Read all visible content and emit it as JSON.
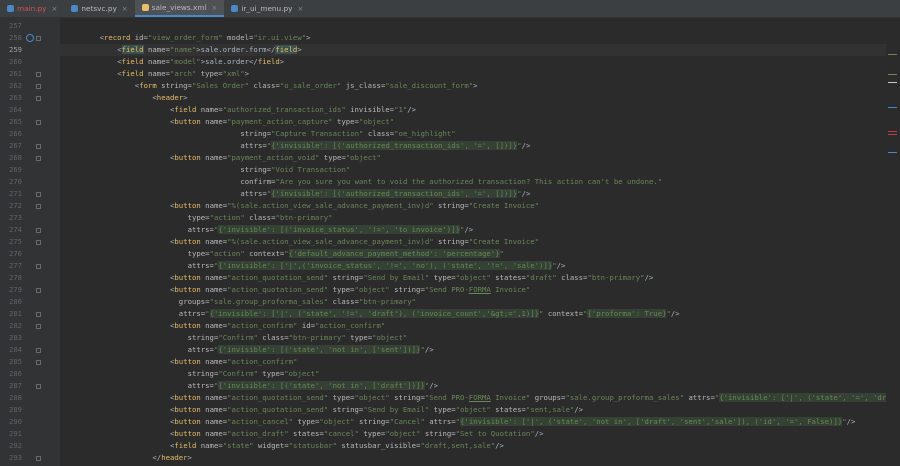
{
  "tabs": [
    {
      "label": "main.py",
      "active": false,
      "error": true,
      "icon_color": "#4a88c7"
    },
    {
      "label": "netsvc.py",
      "active": false,
      "error": false,
      "icon_color": "#4a88c7"
    },
    {
      "label": "sale_views.xml",
      "active": true,
      "error": false,
      "icon_color": "#e8bf6a"
    },
    {
      "label": "ir_ui_menu.py",
      "active": false,
      "error": false,
      "icon_color": "#4a88c7"
    }
  ],
  "inspections": {
    "errors": "6",
    "error_icon": "error-circle-icon",
    "warnings": "2",
    "warning_icon": "warning-triangle-icon",
    "ok": "58",
    "ok_icon": "checkmark-icon",
    "arrow_up": "˄",
    "arrow_down": "˅"
  },
  "current_line_index": 2,
  "lines": [
    {
      "n": "257",
      "indent": 0,
      "tokens": []
    },
    {
      "n": "258",
      "indent": 1,
      "fold": true,
      "bookmark": true,
      "tokens": [
        [
          "p",
          "<"
        ],
        [
          "t",
          "record "
        ],
        [
          "a",
          "id="
        ],
        [
          "v",
          "\"view_order_form\" "
        ],
        [
          "a",
          "model="
        ],
        [
          "v",
          "\"ir.ui.view\""
        ],
        [
          "p",
          ">"
        ]
      ]
    },
    {
      "n": "259",
      "indent": 2,
      "tokens": [
        [
          "p",
          "<"
        ],
        [
          "t",
          "field",
          "tg"
        ],
        [
          "a",
          " name="
        ],
        [
          "v",
          "\"name\""
        ],
        [
          "p",
          ">sale.order.form</"
        ],
        [
          "t",
          "field",
          "tg"
        ],
        [
          "p",
          ">"
        ]
      ]
    },
    {
      "n": "260",
      "indent": 2,
      "tokens": [
        [
          "p",
          "<"
        ],
        [
          "t",
          "field "
        ],
        [
          "a",
          "name="
        ],
        [
          "v",
          "\"model\""
        ],
        [
          "p",
          ">sale.order</"
        ],
        [
          "t",
          "field"
        ],
        [
          "p",
          ">"
        ]
      ]
    },
    {
      "n": "261",
      "indent": 2,
      "fold": true,
      "tokens": [
        [
          "p",
          "<"
        ],
        [
          "t",
          "field "
        ],
        [
          "a",
          "name="
        ],
        [
          "v",
          "\"arch\" "
        ],
        [
          "a",
          "type="
        ],
        [
          "v",
          "\"xml\""
        ],
        [
          "p",
          ">"
        ]
      ]
    },
    {
      "n": "262",
      "indent": 3,
      "fold": true,
      "tokens": [
        [
          "p",
          "<"
        ],
        [
          "t",
          "form "
        ],
        [
          "a",
          "string="
        ],
        [
          "v",
          "\"Sales Order\" "
        ],
        [
          "a",
          "class="
        ],
        [
          "v",
          "\"o_sale_order\" "
        ],
        [
          "a",
          "js_class="
        ],
        [
          "v",
          "\"sale_discount_form\""
        ],
        [
          "p",
          ">"
        ]
      ]
    },
    {
      "n": "263",
      "indent": 4,
      "fold": true,
      "tokens": [
        [
          "p",
          "<"
        ],
        [
          "t",
          "header"
        ],
        [
          "p",
          ">"
        ]
      ]
    },
    {
      "n": "264",
      "indent": 5,
      "tokens": [
        [
          "p",
          "<"
        ],
        [
          "t",
          "field "
        ],
        [
          "a",
          "name="
        ],
        [
          "v",
          "\"authorized_transaction_ids\" "
        ],
        [
          "a",
          "invisible="
        ],
        [
          "v",
          "\"1\""
        ],
        [
          "p",
          "/>"
        ]
      ]
    },
    {
      "n": "265",
      "indent": 5,
      "fold": true,
      "tokens": [
        [
          "p",
          "<"
        ],
        [
          "t",
          "button "
        ],
        [
          "a",
          "name="
        ],
        [
          "v",
          "\"payment_action_capture\" "
        ],
        [
          "a",
          "type="
        ],
        [
          "v",
          "\"object\""
        ]
      ]
    },
    {
      "n": "266",
      "indent": 9,
      "tokens": [
        [
          "a",
          "string="
        ],
        [
          "v",
          "\"Capture Transaction\" "
        ],
        [
          "a",
          "class="
        ],
        [
          "v",
          "\"oe_highlight\""
        ]
      ]
    },
    {
      "n": "267",
      "indent": 9,
      "fold": true,
      "tokens": [
        [
          "a",
          "attrs="
        ],
        [
          "v",
          "\""
        ],
        [
          "v",
          "{'invisible': [('authorized_transaction_ids', '=', [])]}",
          "hl"
        ],
        [
          "v",
          "\""
        ],
        [
          "p",
          "/>"
        ]
      ]
    },
    {
      "n": "268",
      "indent": 5,
      "fold": true,
      "tokens": [
        [
          "p",
          "<"
        ],
        [
          "t",
          "button "
        ],
        [
          "a",
          "name="
        ],
        [
          "v",
          "\"payment_action_void\" "
        ],
        [
          "a",
          "type="
        ],
        [
          "v",
          "\"object\""
        ]
      ]
    },
    {
      "n": "269",
      "indent": 9,
      "tokens": [
        [
          "a",
          "string="
        ],
        [
          "v",
          "\"Void Transaction\""
        ]
      ]
    },
    {
      "n": "270",
      "indent": 9,
      "tokens": [
        [
          "a",
          "confirm="
        ],
        [
          "v",
          "\"Are you sure you want to void the authorized transaction? This action can't be undone.\""
        ]
      ]
    },
    {
      "n": "271",
      "indent": 9,
      "fold": true,
      "tokens": [
        [
          "a",
          "attrs="
        ],
        [
          "v",
          "\""
        ],
        [
          "v",
          "{'invisible': [('authorized_transaction_ids', '=', [])]}",
          "hl"
        ],
        [
          "v",
          "\""
        ],
        [
          "p",
          "/>"
        ]
      ]
    },
    {
      "n": "272",
      "indent": 5,
      "fold": true,
      "tokens": [
        [
          "p",
          "<"
        ],
        [
          "t",
          "button "
        ],
        [
          "a",
          "name="
        ],
        [
          "v",
          "\"%(sale.action_view_sale_advance_payment_inv)d\" "
        ],
        [
          "a",
          "string="
        ],
        [
          "v",
          "\"Create Invoice\""
        ]
      ]
    },
    {
      "n": "273",
      "indent": 6,
      "tokens": [
        [
          "a",
          "type="
        ],
        [
          "v",
          "\"action\" "
        ],
        [
          "a",
          "class="
        ],
        [
          "v",
          "\"btn-primary\""
        ]
      ]
    },
    {
      "n": "274",
      "indent": 6,
      "fold": true,
      "tokens": [
        [
          "a",
          "attrs="
        ],
        [
          "v",
          "\""
        ],
        [
          "v",
          "{'invisible': [('invoice_status', '!=', 'to invoice')]}",
          "hl"
        ],
        [
          "v",
          "\""
        ],
        [
          "p",
          "/>"
        ]
      ]
    },
    {
      "n": "275",
      "indent": 5,
      "fold": true,
      "tokens": [
        [
          "p",
          "<"
        ],
        [
          "t",
          "button "
        ],
        [
          "a",
          "name="
        ],
        [
          "v",
          "\"%(sale.action_view_sale_advance_payment_inv)d\" "
        ],
        [
          "a",
          "string="
        ],
        [
          "v",
          "\"Create Invoice\""
        ]
      ]
    },
    {
      "n": "276",
      "indent": 6,
      "tokens": [
        [
          "a",
          "type="
        ],
        [
          "v",
          "\"action\" "
        ],
        [
          "a",
          "context="
        ],
        [
          "v",
          "\""
        ],
        [
          "v",
          "{'default_advance_payment_method': 'percentage'}",
          "hl"
        ],
        [
          "v",
          "\""
        ]
      ]
    },
    {
      "n": "277",
      "indent": 6,
      "fold": true,
      "tokens": [
        [
          "a",
          "attrs="
        ],
        [
          "v",
          "\""
        ],
        [
          "v",
          "{'invisible': ['|',('invoice_status', '!=', 'no'), ('state', '!=', 'sale')]}",
          "hl"
        ],
        [
          "v",
          "\""
        ],
        [
          "p",
          "/>"
        ]
      ]
    },
    {
      "n": "278",
      "indent": 5,
      "tokens": [
        [
          "p",
          "<"
        ],
        [
          "t",
          "button "
        ],
        [
          "a",
          "name="
        ],
        [
          "v",
          "\"action_quotation_send\" "
        ],
        [
          "a",
          "string="
        ],
        [
          "v",
          "\"Send by Email\" "
        ],
        [
          "a",
          "type="
        ],
        [
          "v",
          "\"object\" "
        ],
        [
          "a",
          "states="
        ],
        [
          "v",
          "\"draft\" "
        ],
        [
          "a",
          "class="
        ],
        [
          "v",
          "\"btn-primary\""
        ],
        [
          "p",
          "/>"
        ]
      ]
    },
    {
      "n": "279",
      "indent": 5,
      "fold": true,
      "tokens": [
        [
          "p",
          "<"
        ],
        [
          "t",
          "button "
        ],
        [
          "a",
          "name="
        ],
        [
          "v",
          "\"action_quotation_send\" "
        ],
        [
          "a",
          "type="
        ],
        [
          "v",
          "\"object\" "
        ],
        [
          "a",
          "string="
        ],
        [
          "v",
          "\"Send PRO-"
        ],
        [
          "v",
          "FORMA",
          "ul"
        ],
        [
          "v",
          " Invoice\""
        ]
      ]
    },
    {
      "n": "280",
      "indent": 5.5,
      "tokens": [
        [
          "a",
          "groups="
        ],
        [
          "v",
          "\"sale.group_proforma_sales\" "
        ],
        [
          "a",
          "class="
        ],
        [
          "v",
          "\"btn-primary\""
        ]
      ]
    },
    {
      "n": "281",
      "indent": 5.5,
      "fold": true,
      "tokens": [
        [
          "a",
          "attrs="
        ],
        [
          "v",
          "\""
        ],
        [
          "v",
          "{'invisible': ['|', ('state', '!=', 'draft'), ('invoice_count','&gt;=',1)]}",
          "hl"
        ],
        [
          "v",
          "\" "
        ],
        [
          "a",
          "context="
        ],
        [
          "v",
          "\""
        ],
        [
          "v",
          "{'proforma': True}",
          "hl"
        ],
        [
          "v",
          "\""
        ],
        [
          "p",
          "/>"
        ]
      ]
    },
    {
      "n": "282",
      "indent": 5,
      "fold": true,
      "tokens": [
        [
          "p",
          "<"
        ],
        [
          "t",
          "button "
        ],
        [
          "a",
          "name="
        ],
        [
          "v",
          "\"action_confirm\" "
        ],
        [
          "a",
          "id="
        ],
        [
          "v",
          "\"action_confirm\""
        ]
      ]
    },
    {
      "n": "283",
      "indent": 6,
      "tokens": [
        [
          "a",
          "string="
        ],
        [
          "v",
          "\"Confirm\" "
        ],
        [
          "a",
          "class="
        ],
        [
          "v",
          "\"btn-primary\" "
        ],
        [
          "a",
          "type="
        ],
        [
          "v",
          "\"object\""
        ]
      ]
    },
    {
      "n": "284",
      "indent": 6,
      "fold": true,
      "tokens": [
        [
          "a",
          "attrs="
        ],
        [
          "v",
          "\""
        ],
        [
          "v",
          "{'invisible': [('state', 'not in', ['sent'])]}",
          "hl"
        ],
        [
          "v",
          "\""
        ],
        [
          "p",
          "/>"
        ]
      ]
    },
    {
      "n": "285",
      "indent": 5,
      "fold": true,
      "tokens": [
        [
          "p",
          "<"
        ],
        [
          "t",
          "button "
        ],
        [
          "a",
          "name="
        ],
        [
          "v",
          "\"action_confirm\""
        ]
      ]
    },
    {
      "n": "286",
      "indent": 6,
      "tokens": [
        [
          "a",
          "string="
        ],
        [
          "v",
          "\"Confirm\" "
        ],
        [
          "a",
          "type="
        ],
        [
          "v",
          "\"object\""
        ]
      ]
    },
    {
      "n": "287",
      "indent": 6,
      "fold": true,
      "tokens": [
        [
          "a",
          "attrs="
        ],
        [
          "v",
          "\""
        ],
        [
          "v",
          "{'invisible': [('state', 'not in', ['draft'])]}",
          "hl"
        ],
        [
          "v",
          "\""
        ],
        [
          "p",
          "/>"
        ]
      ]
    },
    {
      "n": "288",
      "indent": 5,
      "tokens": [
        [
          "p",
          "<"
        ],
        [
          "t",
          "button "
        ],
        [
          "a",
          "name="
        ],
        [
          "v",
          "\"action_quotation_send\" "
        ],
        [
          "a",
          "type="
        ],
        [
          "v",
          "\"object\" "
        ],
        [
          "a",
          "string="
        ],
        [
          "v",
          "\"Send PRO-"
        ],
        [
          "v",
          "FORMA",
          "ul"
        ],
        [
          "v",
          " Invoice\" "
        ],
        [
          "a",
          "groups="
        ],
        [
          "v",
          "\"sale.group_proforma_sales\" "
        ],
        [
          "a",
          "attrs="
        ],
        [
          "v",
          "\""
        ],
        [
          "v",
          "{'invisible': ['|', ('state', '=', 'draft'",
          "hl"
        ]
      ]
    },
    {
      "n": "289",
      "indent": 5,
      "tokens": [
        [
          "p",
          "<"
        ],
        [
          "t",
          "button "
        ],
        [
          "a",
          "name="
        ],
        [
          "v",
          "\"action_quotation_send\" "
        ],
        [
          "a",
          "string="
        ],
        [
          "v",
          "\"Send by Email\" "
        ],
        [
          "a",
          "type="
        ],
        [
          "v",
          "\"object\" "
        ],
        [
          "a",
          "states="
        ],
        [
          "v",
          "\"sent,sale\""
        ],
        [
          "p",
          "/>"
        ]
      ]
    },
    {
      "n": "290",
      "indent": 5,
      "tokens": [
        [
          "p",
          "<"
        ],
        [
          "t",
          "button "
        ],
        [
          "a",
          "name="
        ],
        [
          "v",
          "\"action_cancel\" "
        ],
        [
          "a",
          "type="
        ],
        [
          "v",
          "\"object\" "
        ],
        [
          "a",
          "string="
        ],
        [
          "v",
          "\"Cancel\" "
        ],
        [
          "a",
          "attrs="
        ],
        [
          "v",
          "\""
        ],
        [
          "v",
          "{'invisible': ['|', ('state', 'not in', ['draft', 'sent','sale']), ('id', '=', False)]}",
          "hl"
        ],
        [
          "v",
          "\""
        ],
        [
          "p",
          "/>"
        ]
      ]
    },
    {
      "n": "291",
      "indent": 5,
      "tokens": [
        [
          "p",
          "<"
        ],
        [
          "t",
          "button "
        ],
        [
          "a",
          "name="
        ],
        [
          "v",
          "\"action_draft\" "
        ],
        [
          "a",
          "states="
        ],
        [
          "v",
          "\"cancel\" "
        ],
        [
          "a",
          "type="
        ],
        [
          "v",
          "\"object\" "
        ],
        [
          "a",
          "string="
        ],
        [
          "v",
          "\"Set to Quotation\""
        ],
        [
          "p",
          "/>"
        ]
      ]
    },
    {
      "n": "292",
      "indent": 5,
      "tokens": [
        [
          "p",
          "<"
        ],
        [
          "t",
          "field "
        ],
        [
          "a",
          "name="
        ],
        [
          "v",
          "\"state\" "
        ],
        [
          "a",
          "widget="
        ],
        [
          "v",
          "\"statusbar\" "
        ],
        [
          "a",
          "statusbar_visible="
        ],
        [
          "v",
          "\"draft,sent,sale\""
        ],
        [
          "p",
          "/>"
        ]
      ]
    },
    {
      "n": "293",
      "indent": 4,
      "fold": true,
      "tokens": [
        [
          "p",
          "</"
        ],
        [
          "t",
          "header"
        ],
        [
          "p",
          ">"
        ]
      ]
    }
  ],
  "scroll_marks": [
    {
      "color": "#6a8759",
      "row": 3.6
    },
    {
      "color": "#6a8759",
      "row": 5.6
    },
    {
      "color": "#c9c9c9",
      "row": 6.4
    },
    {
      "color": "#4a88c7",
      "row": 8.9
    },
    {
      "color": "#bc3f3c",
      "row": 11.3
    },
    {
      "color": "#bc3f3c",
      "row": 11.6
    },
    {
      "color": "#4a88c7",
      "row": 13.4
    }
  ]
}
